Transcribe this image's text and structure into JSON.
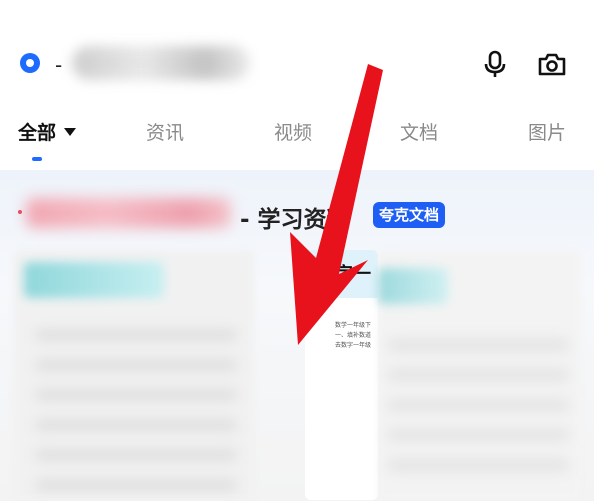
{
  "search_bar": {
    "separator": "-",
    "query_text": "",
    "icons": {
      "logo": "quark-logo-icon",
      "mic": "microphone-icon",
      "camera": "camera-icon"
    }
  },
  "tabs": [
    {
      "label": "全部",
      "active": true
    },
    {
      "label": "资讯",
      "active": false
    },
    {
      "label": "视频",
      "active": false
    },
    {
      "label": "文档",
      "active": false
    },
    {
      "label": "图片",
      "active": false
    }
  ],
  "result": {
    "title_suffix": "- 学习资料",
    "source_badge": "夸克文档",
    "thumb_header": "字一",
    "thumb_lines": [
      "数学一年级下",
      "一、填补数道",
      "去数字一年级"
    ]
  },
  "colors": {
    "accent": "#1e6bff",
    "badge": "#1f5ef5",
    "arrow": "#e8121c"
  }
}
